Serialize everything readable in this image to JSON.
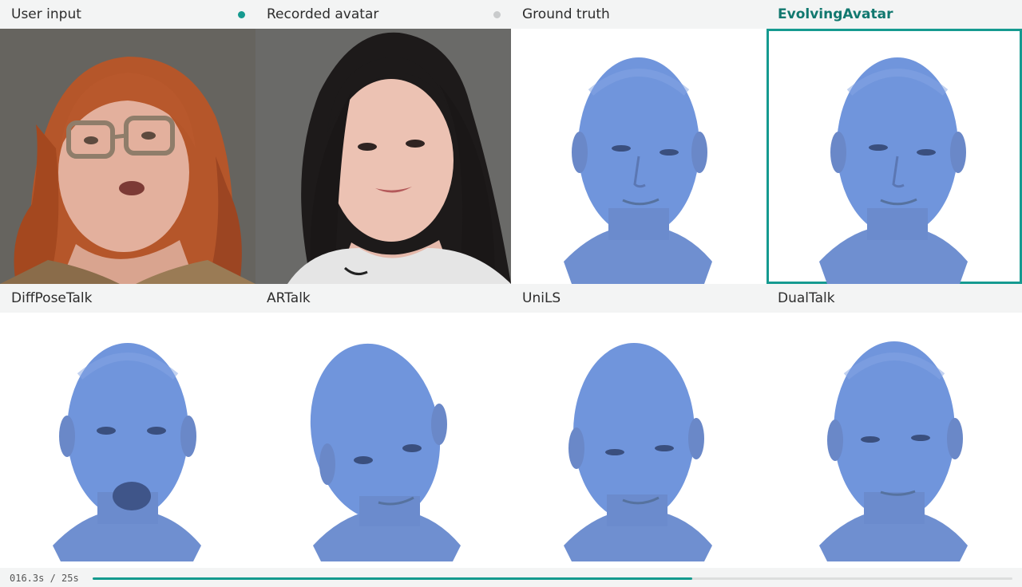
{
  "top_labels": {
    "user_input": "User input",
    "recorded_avatar": "Recorded avatar",
    "ground_truth": "Ground truth",
    "evolving_avatar": "EvolvingAvatar"
  },
  "bottom_labels": {
    "diffposetalk": "DiffPoseTalk",
    "artalk": "ARTalk",
    "unils": "UniLS",
    "dualtalk": "DualTalk"
  },
  "indicators": {
    "user_input_color": "#169a8f",
    "recorded_avatar_color": "#c9cbcc"
  },
  "highlight_color": "#159a90",
  "mesh_color": "#6f8fd0",
  "playback": {
    "time_text": "016.3s / 25s",
    "current_seconds": 16.3,
    "total_seconds": 25,
    "progress": 0.652
  }
}
